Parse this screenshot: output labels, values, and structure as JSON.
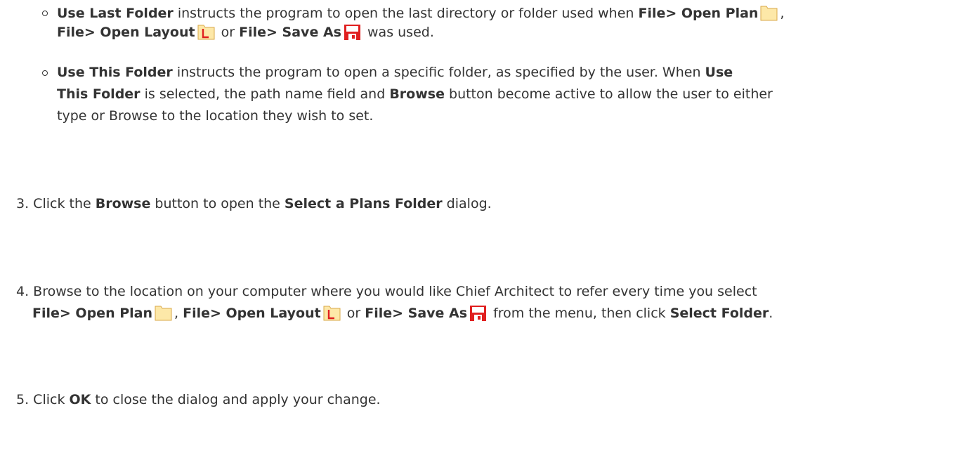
{
  "colors": {
    "text": "#333333",
    "folder_fill": "#fde8a8",
    "folder_stroke": "#d9a94a",
    "layout_red": "#e02020",
    "save_red": "#e02020"
  },
  "icons": {
    "open_plan": "folder-icon",
    "open_layout": "layout-file-icon",
    "save_as": "floppy-disk-icon"
  },
  "bullets": [
    {
      "term": "Use Last Folder",
      "line1_text": " instructs the program to open the last directory or folder used when ",
      "open_plan": "File> Open Plan",
      "comma": ",",
      "open_layout": "File> Open Layout",
      "or": " or ",
      "save_as": "File> Save As",
      "tail": " was used."
    },
    {
      "term": "Use This Folder",
      "line1_text": " instructs the program to open a specific folder, as specified by the user. When ",
      "term_repeat_a": "Use",
      "term_repeat_b": "This Folder",
      "line2_text": " is selected, the path name field and ",
      "browse": "Browse",
      "line2_tail": " button become active to allow the user to either",
      "line3_text": "type or Browse to the location they wish to set."
    }
  ],
  "steps": [
    {
      "number": "3.",
      "pre": " Click the ",
      "browse": "Browse",
      "mid": " button to open the ",
      "dialog": "Select a Plans Folder",
      "tail": " dialog."
    },
    {
      "number": "4.",
      "pre": " Browse to the location on your computer where you would like Chief Architect to refer every time you select",
      "open_plan": "File> Open Plan",
      "comma": ",",
      "open_layout": "File> Open Layout",
      "or": " or ",
      "save_as": "File> Save As",
      "mid": " from the menu, then click ",
      "select_folder": "Select Folder",
      "period": "."
    },
    {
      "number": "5.",
      "pre": " Click ",
      "ok": "OK",
      "tail": " to close the dialog and apply your change."
    }
  ]
}
